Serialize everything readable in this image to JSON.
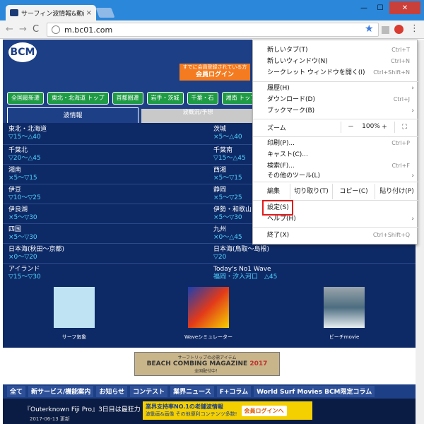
{
  "browser": {
    "tab_title": "サーフィン波情報&動画",
    "tab_close": "×",
    "win_min": "—",
    "win_max": "☐",
    "win_close": "✕",
    "back": "←",
    "forward": "→",
    "reload": "C",
    "url": "m.bc01.com",
    "star": "★",
    "menu_glyph": "⋮"
  },
  "site": {
    "logo": "BCM",
    "login_small": "すでに会員登録されている方",
    "login_big": "会員ログイン",
    "pills": [
      "全国最新遷",
      "東北・北海道 トップ",
      "首都圏遷",
      "岩手・茨城",
      "千葉・石",
      "湘南 トップ"
    ],
    "wave_tab": "波情報",
    "wave_tab2": "波概況/予想",
    "regions": [
      {
        "name": "東北・北海道",
        "val": "▽15〜△40"
      },
      {
        "name": "茨城",
        "val": "×5〜△40"
      },
      {
        "name": "千葉北",
        "val": "▽20〜△45"
      },
      {
        "name": "千葉南",
        "val": "▽15〜△45"
      },
      {
        "name": "湘南",
        "val": "×5〜▽15"
      },
      {
        "name": "西湘",
        "val": "×5〜▽15"
      },
      {
        "name": "伊豆",
        "val": "▽10〜▽25"
      },
      {
        "name": "静岡",
        "val": "×5〜▽25"
      },
      {
        "name": "伊良湖",
        "val": "×5〜▽30"
      },
      {
        "name": "伊勢・和歌山",
        "val": "×5〜▽30"
      },
      {
        "name": "四国",
        "val": "×5〜▽30"
      },
      {
        "name": "九州",
        "val": "×0〜△45"
      },
      {
        "name": "日本海(秋田〜京都)",
        "val": "×0〜▽20"
      },
      {
        "name": "日本海(鳥取〜島根)",
        "val": "▽20"
      },
      {
        "name": "アイランド",
        "val": "▽15〜▽30"
      },
      {
        "name": "Today's No1 Wave",
        "val": "福岡・汐入河口　△45"
      }
    ],
    "thumbs": [
      "サーフ気象",
      "Waveシミュレーター",
      "ビーチmovie"
    ],
    "banner_small": "サーフトリップの必需アイテム",
    "banner_title": "BEACH COMBING MAGAZINE",
    "banner_year": "2017",
    "banner_sub": "全国配付中！",
    "cats": [
      "全て",
      "新サービス/機能案内",
      "お知らせ",
      "コンテスト",
      "業界ニュース",
      "F+コラム",
      "World Surf Movies BCM限定コラム"
    ],
    "news_title": "『Outerknown Fiji Pro』3日目は最狂力",
    "news_date": "2017-06-13 更新",
    "promo_text1": "業界支持率NO.1の老舗波情報",
    "promo_text2": "波動画&画像 その他便利コンテンツ多数!",
    "promo_login": "会員ログインへ"
  },
  "menu": {
    "new_tab": "新しいタブ(T)",
    "new_tab_sc": "Ctrl+T",
    "new_window": "新しいウィンドウ(N)",
    "new_window_sc": "Ctrl+N",
    "incognito": "シークレット ウィンドウを開く(I)",
    "incognito_sc": "Ctrl+Shift+N",
    "history": "履歴(H)",
    "downloads": "ダウンロード(D)",
    "downloads_sc": "Ctrl+J",
    "bookmarks": "ブックマーク(B)",
    "zoom": "ズーム",
    "zoom_minus": "－",
    "zoom_val": "100%",
    "zoom_plus": "+",
    "fullscreen": "⛶",
    "print": "印刷(P)...",
    "print_sc": "Ctrl+P",
    "cast": "キャスト(C)...",
    "find": "検索(F)...",
    "find_sc": "Ctrl+F",
    "more_tools": "その他のツール(L)",
    "edit": "編集",
    "cut": "切り取り(T)",
    "copy": "コピー(C)",
    "paste": "貼り付け(P)",
    "settings": "設定(S)",
    "help": "ヘルプ(H)",
    "exit": "終了(X)",
    "exit_sc": "Ctrl+Shift+Q",
    "arrow": "›"
  },
  "colors": {
    "accent": "#2b87d9",
    "site_navy": "#1d3f86",
    "highlight": "#e21b1b"
  }
}
